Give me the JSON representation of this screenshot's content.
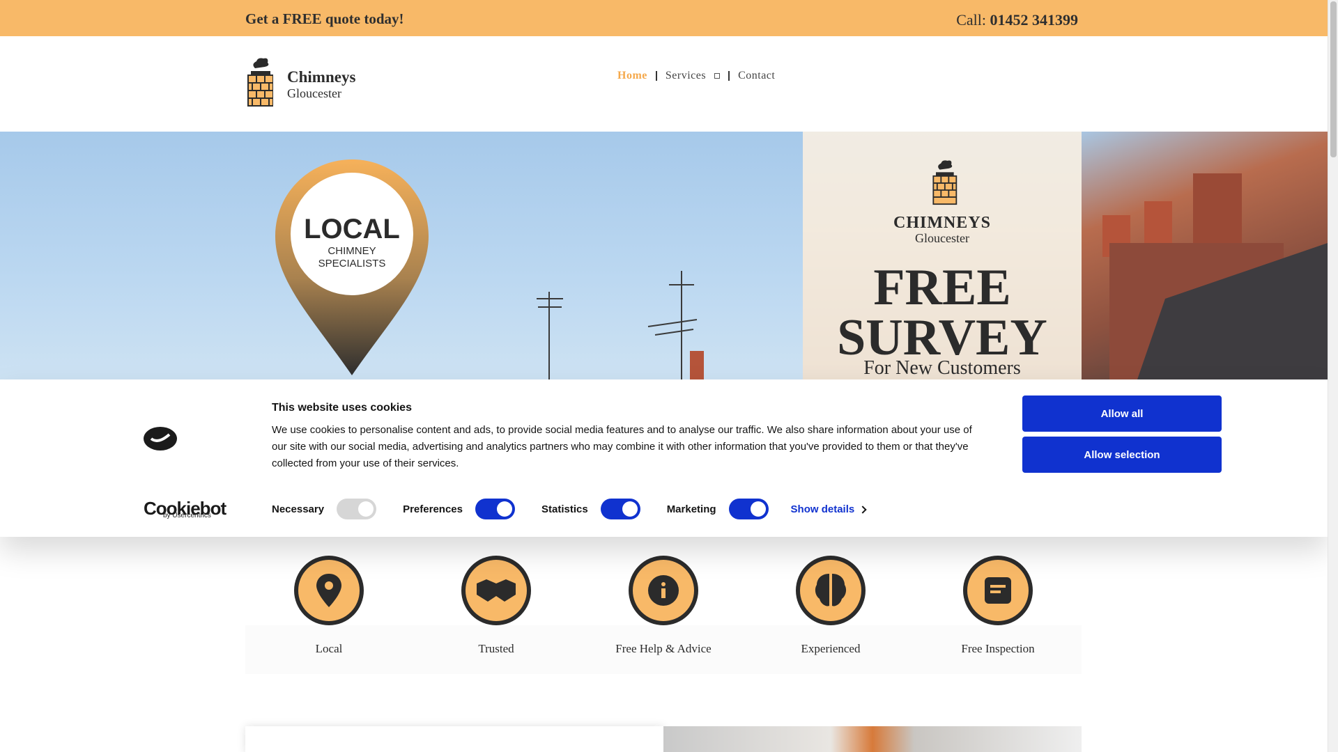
{
  "topbar": {
    "quote_text": "Get a FREE quote today!",
    "call_prefix": "Call: ",
    "phone": "01452 341399"
  },
  "header": {
    "brand_name": "Chimneys",
    "brand_city": "Gloucester",
    "nav": [
      {
        "label": "Home",
        "active": true
      },
      {
        "label": "Services",
        "active": false
      },
      {
        "label": "Contact",
        "active": false
      }
    ]
  },
  "hero": {
    "pin_title": "LOCAL",
    "pin_line1": "CHIMNEY",
    "pin_line2": "SPECIALISTS",
    "panel_brand": "CHIMNEYS",
    "panel_city": "Gloucester",
    "panel_big1": "FREE",
    "panel_big2": "SURVEY",
    "panel_sub": "For New Customers"
  },
  "cookie": {
    "title": "This website uses cookies",
    "text": "We use cookies to personalise content and ads, to provide social media features and to analyse our traffic. We also share information about your use of our site with our social media, advertising and analytics partners who may combine it with other information that you've provided to them or that they've collected from your use of their services.",
    "logo_word": "Cookiebot",
    "logo_by": "by Usercentrics",
    "toggles": [
      {
        "label": "Necessary",
        "on": true,
        "disabled": true
      },
      {
        "label": "Preferences",
        "on": true
      },
      {
        "label": "Statistics",
        "on": true
      },
      {
        "label": "Marketing",
        "on": true
      }
    ],
    "show_details": "Show details",
    "allow_all": "Allow all",
    "allow_selection": "Allow selection",
    "accent": "#1032cf"
  },
  "features": [
    {
      "label": "Local",
      "icon": "map-pin-icon"
    },
    {
      "label": "Trusted",
      "icon": "handshake-icon"
    },
    {
      "label": "Free Help & Advice",
      "icon": "info-icon"
    },
    {
      "label": "Experienced",
      "icon": "brain-icon"
    },
    {
      "label": "Free Inspection",
      "icon": "document-icon"
    }
  ],
  "colors": {
    "orange": "#f8b968",
    "accent_orange": "#f5a94c",
    "dark": "#2b2b2b"
  }
}
